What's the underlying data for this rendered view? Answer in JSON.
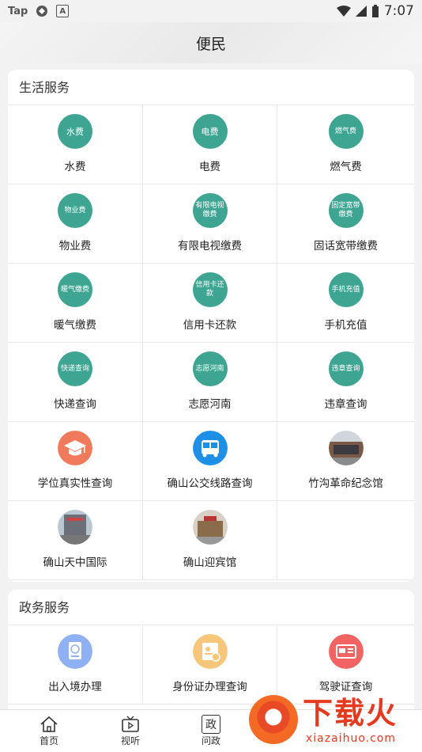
{
  "status_bar": {
    "left_text": "Tap",
    "time": "7:07"
  },
  "header": {
    "title": "便民"
  },
  "life_services": {
    "title": "生活服务",
    "items": [
      {
        "label": "水费",
        "icon_text": "水费",
        "icon": "water-bill-icon"
      },
      {
        "label": "电费",
        "icon_text": "电费",
        "icon": "electricity-bill-icon"
      },
      {
        "label": "燃气费",
        "icon_text": "燃气费",
        "icon": "gas-bill-icon"
      },
      {
        "label": "物业费",
        "icon_text": "物业费",
        "icon": "property-fee-icon"
      },
      {
        "label": "有限电视缴费",
        "icon_text": "有限电视缴费",
        "icon": "cable-tv-icon"
      },
      {
        "label": "固话宽带缴费",
        "icon_text": "固定宽带缴费",
        "icon": "broadband-icon"
      },
      {
        "label": "暖气缴费",
        "icon_text": "暖气缴费",
        "icon": "heating-icon"
      },
      {
        "label": "信用卡还款",
        "icon_text": "信用卡还款",
        "icon": "credit-card-icon"
      },
      {
        "label": "手机充值",
        "icon_text": "手机充值",
        "icon": "phone-recharge-icon"
      },
      {
        "label": "快递查询",
        "icon_text": "快递查询",
        "icon": "express-query-icon"
      },
      {
        "label": "志愿河南",
        "icon_text": "志愿河南",
        "icon": "volunteer-icon"
      },
      {
        "label": "违章查询",
        "icon_text": "违章查询",
        "icon": "violation-query-icon"
      },
      {
        "label": "学位真实性查询",
        "icon_text": "",
        "icon": "graduation-cap-icon"
      },
      {
        "label": "确山公交线路查询",
        "icon_text": "",
        "icon": "bus-icon"
      },
      {
        "label": "竹沟革命纪念馆",
        "icon_text": "",
        "icon": "memorial-hall-photo-icon"
      },
      {
        "label": "确山天中国际",
        "icon_text": "",
        "icon": "tianzhong-building-photo-icon"
      },
      {
        "label": "确山迎宾馆",
        "icon_text": "",
        "icon": "guesthouse-photo-icon"
      }
    ]
  },
  "gov_services": {
    "title": "政务服务",
    "items": [
      {
        "label": "出入境办理",
        "icon": "passport-icon"
      },
      {
        "label": "身份证办理查询",
        "icon": "id-card-icon"
      },
      {
        "label": "驾驶证查询",
        "icon": "driver-license-icon"
      }
    ]
  },
  "tabbar": {
    "tabs": [
      {
        "label": "首页",
        "icon": "home-icon"
      },
      {
        "label": "视听",
        "icon": "tv-icon"
      },
      {
        "label": "问政",
        "icon": "politics-icon",
        "glyph": "政"
      }
    ]
  },
  "watermark": {
    "title": "下载火",
    "url": "xiazaihuo.com"
  }
}
